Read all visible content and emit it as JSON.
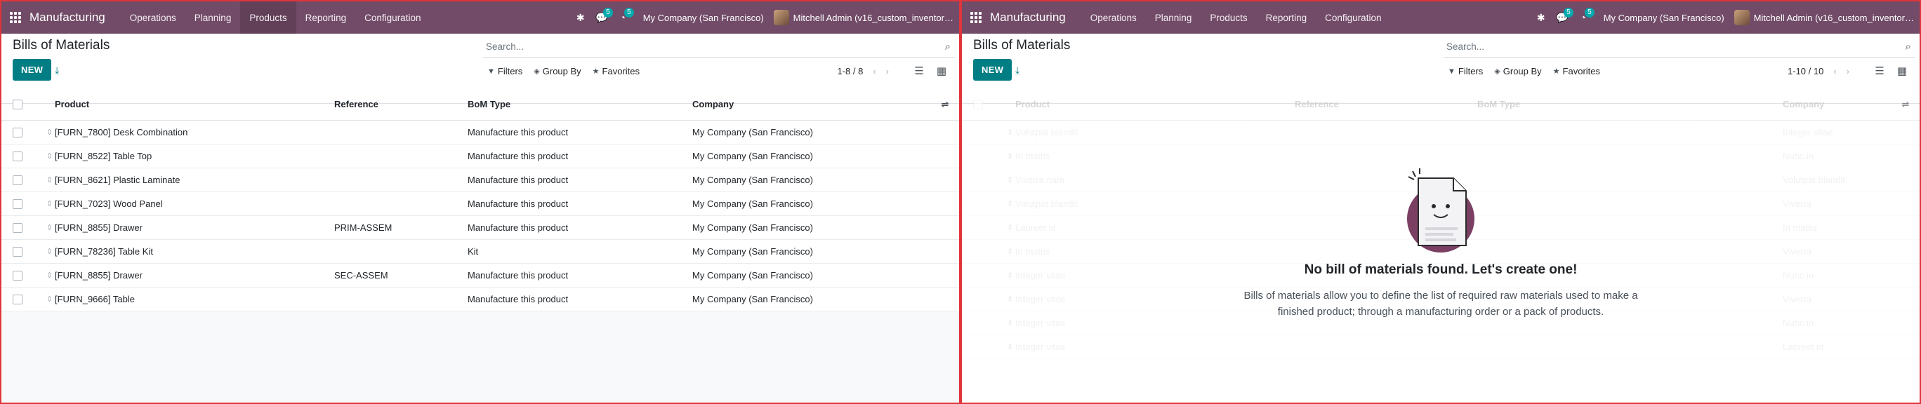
{
  "navbar": {
    "app_name": "Manufacturing",
    "menu": [
      "Operations",
      "Planning",
      "Products",
      "Reporting",
      "Configuration"
    ],
    "active_menu": "Products",
    "messages_count": "5",
    "activities_count": "5",
    "company": "My Company (San Francisco)",
    "user": "Mitchell Admin (v16_custom_inventor…"
  },
  "left": {
    "title": "Bills of Materials",
    "search_placeholder": "Search...",
    "new_label": "NEW",
    "filters_label": "Filters",
    "groupby_label": "Group By",
    "favorites_label": "Favorites",
    "pager": "1-8 / 8",
    "columns": [
      "Product",
      "Reference",
      "BoM Type",
      "Company"
    ],
    "rows": [
      {
        "product": "[FURN_7800] Desk Combination",
        "reference": "",
        "type": "Manufacture this product",
        "company": "My Company (San Francisco)"
      },
      {
        "product": "[FURN_8522] Table Top",
        "reference": "",
        "type": "Manufacture this product",
        "company": "My Company (San Francisco)"
      },
      {
        "product": "[FURN_8621] Plastic Laminate",
        "reference": "",
        "type": "Manufacture this product",
        "company": "My Company (San Francisco)"
      },
      {
        "product": "[FURN_7023] Wood Panel",
        "reference": "",
        "type": "Manufacture this product",
        "company": "My Company (San Francisco)"
      },
      {
        "product": "[FURN_8855] Drawer",
        "reference": "PRIM-ASSEM",
        "type": "Manufacture this product",
        "company": "My Company (San Francisco)"
      },
      {
        "product": "[FURN_78236] Table Kit",
        "reference": "",
        "type": "Kit",
        "company": "My Company (San Francisco)"
      },
      {
        "product": "[FURN_8855] Drawer",
        "reference": "SEC-ASSEM",
        "type": "Manufacture this product",
        "company": "My Company (San Francisco)"
      },
      {
        "product": "[FURN_9666] Table",
        "reference": "",
        "type": "Manufacture this product",
        "company": "My Company (San Francisco)"
      }
    ]
  },
  "right": {
    "title": "Bills of Materials",
    "search_placeholder": "Search...",
    "new_label": "NEW",
    "filters_label": "Filters",
    "groupby_label": "Group By",
    "favorites_label": "Favorites",
    "pager": "1-10 / 10",
    "columns": [
      "Product",
      "Reference",
      "BoM Type",
      "Company"
    ],
    "ghost_rows": [
      {
        "product": "Volutpat blandit",
        "company": "Integer vitae"
      },
      {
        "product": "In mattis",
        "company": "Nunc in"
      },
      {
        "product": "Viverra nam",
        "company": "Volutpat blandit"
      },
      {
        "product": "Volutpat blandit",
        "company": "Viverra"
      },
      {
        "product": "Laoreet id",
        "company": "In mattis"
      },
      {
        "product": "In mattis",
        "company": "Viverra"
      },
      {
        "product": "Integer vitae",
        "company": "Nunc in"
      },
      {
        "product": "Integer vitae",
        "company": "Viverra"
      },
      {
        "product": "Integer vitae",
        "company": "Nunc in"
      },
      {
        "product": "Integer vitae",
        "company": "Laoreet id"
      }
    ],
    "empty_title": "No bill of materials found. Let's create one!",
    "empty_text": "Bills of materials allow you to define the list of required raw materials used to make a finished product; through a manufacturing order or a pack of products."
  },
  "icons": {
    "apps": "apps-grid-icon",
    "bug": "bug-icon",
    "messages": "chat-icon",
    "activities": "clock-icon",
    "download": "download-icon",
    "search": "search-icon",
    "filter": "filter-icon",
    "groupby": "layers-icon",
    "favorites": "star-icon",
    "list_view": "list-view-icon",
    "kanban_view": "kanban-view-icon",
    "optional_columns": "sliders-icon"
  },
  "colors": {
    "navbar": "#714b67",
    "primary_button": "#017e84",
    "badge": "#01a9ac"
  }
}
